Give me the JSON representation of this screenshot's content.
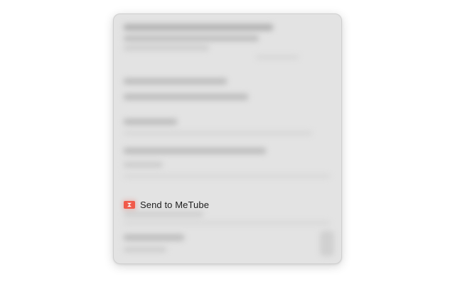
{
  "context_menu": {
    "highlighted_item": {
      "label": "Send to MeTube",
      "icon": "metube-icon",
      "icon_color": "#f05a4a"
    }
  },
  "colors": {
    "menu_background": "#e3e3e3",
    "accent": "#f05a4a"
  }
}
